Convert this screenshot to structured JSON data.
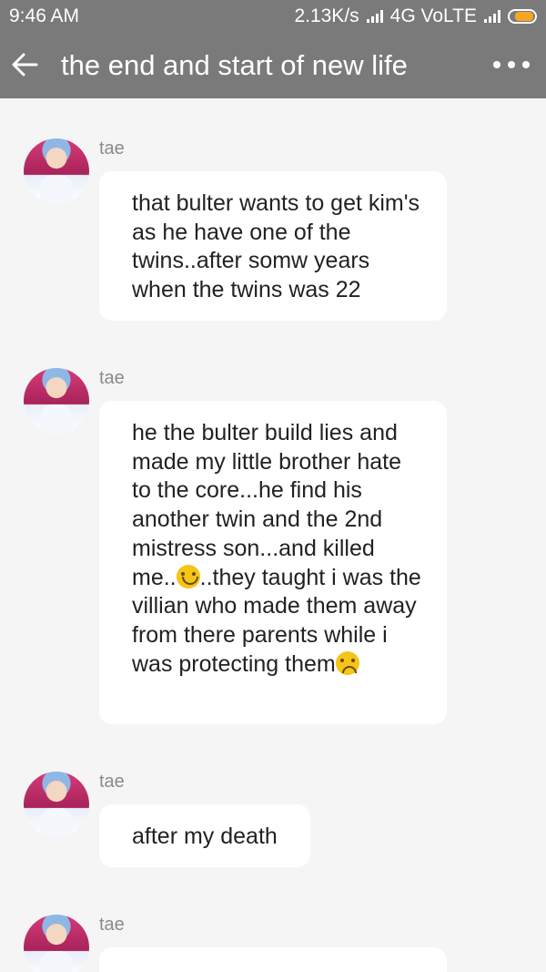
{
  "status_bar": {
    "time": "9:46 AM",
    "speed": "2.13K/s",
    "network": "4G VoLTE"
  },
  "app_bar": {
    "title": "the end and start of new life"
  },
  "messages": [
    {
      "sender": "tae",
      "text": "that bulter wants to get kim's as he have one of the twins..after somw years when the twins was 22"
    },
    {
      "sender": "tae",
      "text_parts": [
        "he the bulter build lies and made my little brother hate to the core...he find his another twin and the 2nd mistress son...and killed me..",
        "..they taught i was the villian who made them away from there parents while i was protecting them"
      ]
    },
    {
      "sender": "tae",
      "text": "after my death"
    },
    {
      "sender": "tae",
      "text": ""
    }
  ],
  "icons": {
    "back": "arrow-back-icon",
    "more": "more-options-icon",
    "smile_emoji": "smiling-face-emoji",
    "frown_emoji": "frowning-face-emoji"
  },
  "colors": {
    "app_bar": "#7a7a7a",
    "background": "#f5f5f5",
    "bubble": "#ffffff",
    "battery": "#f5a623"
  }
}
